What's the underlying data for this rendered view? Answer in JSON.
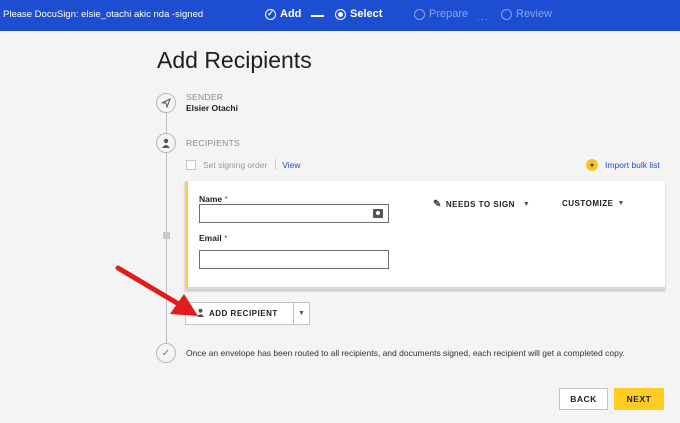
{
  "topbar": {
    "doc_title": "Please DocuSign: elsie_otachi akic nda -signed...",
    "steps": [
      {
        "label": "Add",
        "state": "done",
        "icon": "check-circle-icon"
      },
      {
        "label": "Select",
        "state": "current",
        "icon": "radio-dot-icon"
      },
      {
        "label": "Prepare",
        "state": "pending",
        "icon": "empty-circle-icon"
      },
      {
        "label": "Review",
        "state": "pending",
        "icon": "empty-circle-icon"
      }
    ],
    "accent_color": "#1d4ed1"
  },
  "page": {
    "title": "Add Recipients"
  },
  "sender": {
    "label": "SENDER",
    "name": "Elsier Otachi"
  },
  "recipients": {
    "label": "RECIPIENTS",
    "signing_order_label": "Set signing order",
    "view_label": "View",
    "import_label": "Import bulk list",
    "card": {
      "name_label": "Name",
      "email_label": "Email",
      "required_mark": "*",
      "name_value": "",
      "email_value": "",
      "action_label": "NEEDS TO SIGN",
      "customize_label": "CUSTOMIZE",
      "card_accent": "#f6d24e"
    },
    "add_label": "ADD RECIPIENT"
  },
  "completion_text": "Once an envelope has been routed to all recipients, and documents signed, each recipient will get a completed copy.",
  "footer": {
    "back_label": "BACK",
    "next_label": "NEXT",
    "next_color": "#ffcc22"
  }
}
